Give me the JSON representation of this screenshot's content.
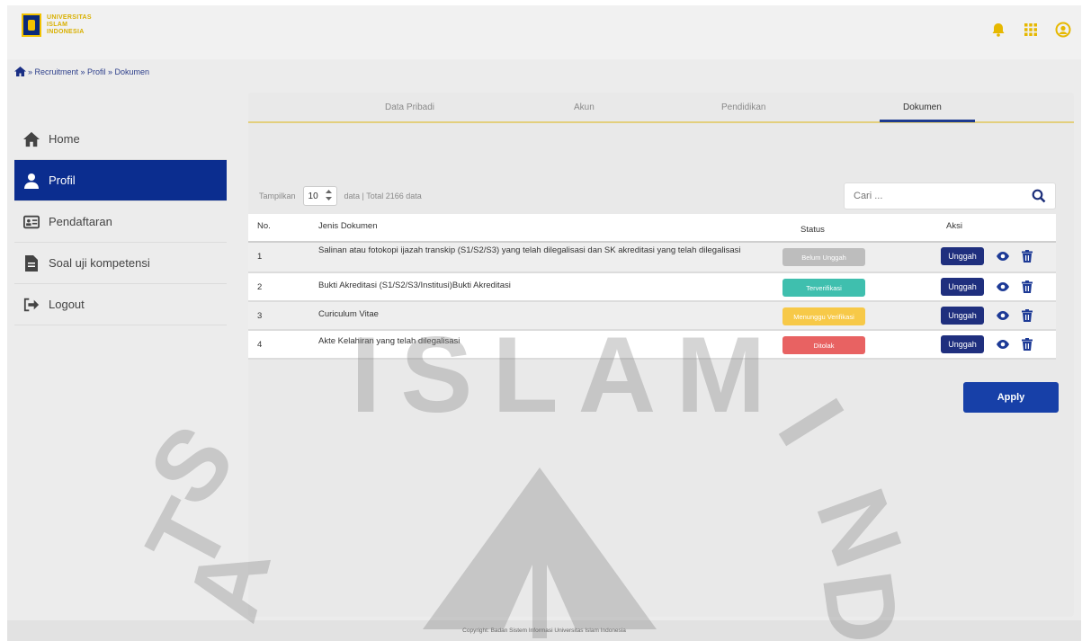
{
  "header": {
    "logo_lines": [
      "UNIVERSITAS",
      "ISLAM",
      "INDONESIA"
    ],
    "icons": [
      "bell-icon",
      "grid-icon",
      "user-circle-icon"
    ],
    "accent_color": "#e6b800"
  },
  "breadcrumb": {
    "text": "» Recruitment » Profil » Dokumen"
  },
  "sidebar": {
    "items": [
      {
        "label": "Home",
        "icon": "home-icon",
        "active": false
      },
      {
        "label": "Profil",
        "icon": "user-icon",
        "active": true
      },
      {
        "label": "Pendaftaran",
        "icon": "id-card-icon",
        "active": false
      },
      {
        "label": "Soal uji kompetensi",
        "icon": "file-icon",
        "active": false
      },
      {
        "label": "Logout",
        "icon": "logout-icon",
        "active": false
      }
    ],
    "active_color": "#0b2d8f"
  },
  "tabs": [
    {
      "label": "Data Pribadi"
    },
    {
      "label": "Akun"
    },
    {
      "label": "Pendidikan"
    },
    {
      "label": "Dokumen",
      "active": true
    }
  ],
  "controls": {
    "show_label": "Tampilkan",
    "per_page": "10",
    "total_text": "data | Total 2166 data",
    "search_placeholder": "Cari ..."
  },
  "table": {
    "headers": {
      "no": "No.",
      "jenis": "Jenis Dokumen",
      "status": "Status",
      "aksi": "Aksi"
    },
    "rows": [
      {
        "no": "1",
        "jenis": "Salinan atau fotokopi ijazah transkip (S1/S2/S3) yang telah dilegalisasi dan SK akreditasi yang telah dilegalisasi",
        "status": "Belum Unggah",
        "status_color": "#bdbdbd"
      },
      {
        "no": "2",
        "jenis": "Bukti Akreditasi (S1/S2/S3/Institusi)Bukti Akreditasi",
        "status": "Terverifikasi",
        "status_color": "#3fbfae"
      },
      {
        "no": "3",
        "jenis": "Curiculum Vitae",
        "status": "Menunggu Verifikasi",
        "status_color": "#f7c948"
      },
      {
        "no": "4",
        "jenis": "Akte Kelahiran yang telah dilegalisasi",
        "status": "Ditolak",
        "status_color": "#e86262"
      }
    ],
    "action_label": "Unggah"
  },
  "apply_label": "Apply",
  "footer": {
    "text": "Copyright: Badan Sistem Informasi Universitas Islam Indonesia"
  },
  "watermark_text": "ISLAM"
}
